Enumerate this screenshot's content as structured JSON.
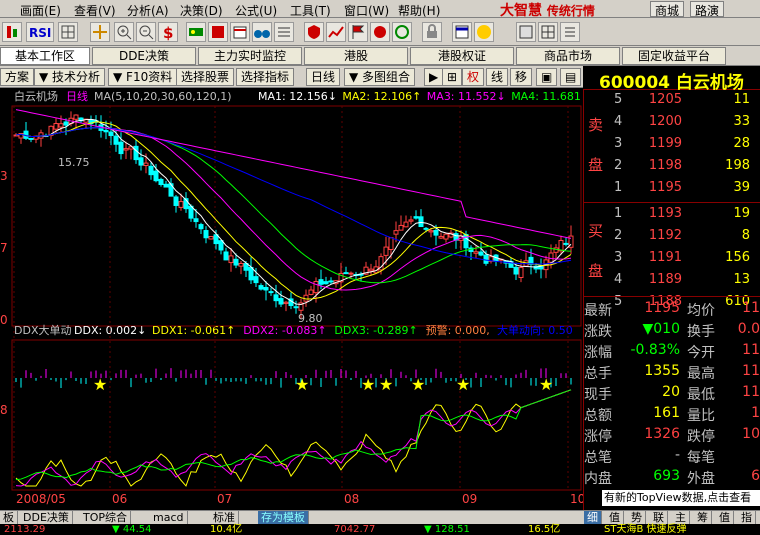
{
  "menu": {
    "items": [
      "画面(E)",
      "查看(V)",
      "分析(A)",
      "决策(D)",
      "公式(U)",
      "工具(T)",
      "窗口(W)",
      "帮助(H)"
    ],
    "brand": "大智慧",
    "brand_sub": "传统行情",
    "mall": "商城",
    "route": "路演"
  },
  "tabs": [
    "基本工作区",
    "DDE决策",
    "主力实时监控",
    "港股",
    "港股权证",
    "商品市场",
    "固定收益平台"
  ],
  "chart_toolbar": {
    "left": "方案",
    "buttons": [
      "技术分析",
      "F10资料",
      "选择股票",
      "选择指标",
      "日线",
      "多图组合",
      "权",
      "线",
      "移"
    ]
  },
  "stock": {
    "code": "600004",
    "name": "白云机场",
    "header": "600004 白云机场"
  },
  "chart": {
    "title": "白云机场",
    "period": "日线",
    "ma_formula": "MA(5,10,20,30,60,120,1)",
    "ma_items": [
      {
        "label": "MA1: 12.156",
        "arrow": "↓",
        "color": "#ffffff"
      },
      {
        "label": "MA2: 12.106",
        "arrow": "↑",
        "color": "#ffff00"
      },
      {
        "label": "MA3: 11.552",
        "arrow": "↓",
        "color": "#ff00ff"
      },
      {
        "label": "MA4: 11.681",
        "arrow": "↓",
        "color": "#00ff00"
      }
    ],
    "high_label": "15.75",
    "low_label": "9.80",
    "y_labels": [
      "3",
      "7",
      "0"
    ],
    "dates": [
      "2008/05",
      "06",
      "07",
      "08",
      "09",
      "10"
    ],
    "ddx_title": "DDX大单动",
    "ddx_items": [
      {
        "label": "DDX: 0.002",
        "arrow": "↓",
        "color": "#ffffff"
      },
      {
        "label": "DDX1: -0.061",
        "arrow": "↑",
        "color": "#ffff00"
      },
      {
        "label": "DDX2: -0.083",
        "arrow": "↑",
        "color": "#ff00ff"
      },
      {
        "label": "DDX3: -0.289",
        "arrow": "↑",
        "color": "#00ff00"
      },
      {
        "label": "预警: 0.000",
        "arrow": ",",
        "color": "#ff8040"
      },
      {
        "label": "大单动向: 0.50",
        "arrow": "",
        "color": "#0000ff"
      }
    ],
    "ddx_y": "8"
  },
  "orderbook": {
    "sell_label": "卖盘",
    "buy_label": "买盘",
    "sell": [
      {
        "level": "5",
        "price": "1205",
        "vol": "11"
      },
      {
        "level": "4",
        "price": "1200",
        "vol": "33"
      },
      {
        "level": "3",
        "price": "1199",
        "vol": "28"
      },
      {
        "level": "2",
        "price": "1198",
        "vol": "198"
      },
      {
        "level": "1",
        "price": "1195",
        "vol": "39"
      }
    ],
    "buy": [
      {
        "level": "1",
        "price": "1193",
        "vol": "19"
      },
      {
        "level": "2",
        "price": "1192",
        "vol": "8"
      },
      {
        "level": "3",
        "price": "1191",
        "vol": "156"
      },
      {
        "level": "4",
        "price": "1189",
        "vol": "13"
      },
      {
        "level": "5",
        "price": "1188",
        "vol": "610"
      }
    ]
  },
  "quotes": [
    {
      "k": "最新",
      "v": "1195",
      "vc": "#ff4040",
      "k2": "均价",
      "v2": "11"
    },
    {
      "k": "涨跌",
      "v": "▼010",
      "vc": "#00ff00",
      "k2": "换手",
      "v2": "0.0"
    },
    {
      "k": "涨幅",
      "v": "-0.83%",
      "vc": "#00ff00",
      "k2": "今开",
      "v2": "11"
    },
    {
      "k": "总手",
      "v": "1355",
      "vc": "#ffff00",
      "k2": "最高",
      "v2": "11"
    },
    {
      "k": "现手",
      "v": "20",
      "vc": "#ffff00",
      "k2": "最低",
      "v2": "11"
    },
    {
      "k": "总额",
      "v": "161",
      "vc": "#ffff00",
      "k2": "量比",
      "v2": "1"
    },
    {
      "k": "涨停",
      "v": "1326",
      "vc": "#ff4040",
      "k2": "跌停",
      "v2": "10"
    },
    {
      "k": "总笔",
      "v": "-",
      "vc": "#c0c0c0",
      "k2": "每笔",
      "v2": ""
    },
    {
      "k": "内盘",
      "v": "693",
      "vc": "#00ff00",
      "k2": "外盘",
      "v2": "6"
    }
  ],
  "notice": "有新的TopView数据,点击查看",
  "bottom_tabs": [
    "板",
    "DDE决策",
    "TOP综合",
    "macd",
    "标准",
    "存为模板"
  ],
  "status": {
    "a": "2113.29",
    "b": "▼ 44.54",
    "c": "10.4亿",
    "d": "7042.77",
    "e": "▼ 128.51",
    "f": "16.5亿",
    "g": "ST天海B 快速反弹"
  },
  "panel_tabs": [
    "细",
    "值",
    "势",
    "联",
    "主",
    "筹",
    "值",
    "指"
  ],
  "colors": {
    "up": "#ff4040",
    "down": "#00ffff",
    "ma1": "#ffffff",
    "ma2": "#ffff00",
    "ma3": "#ff00ff",
    "ma4": "#00ff00",
    "ma5": "#0000ff"
  }
}
